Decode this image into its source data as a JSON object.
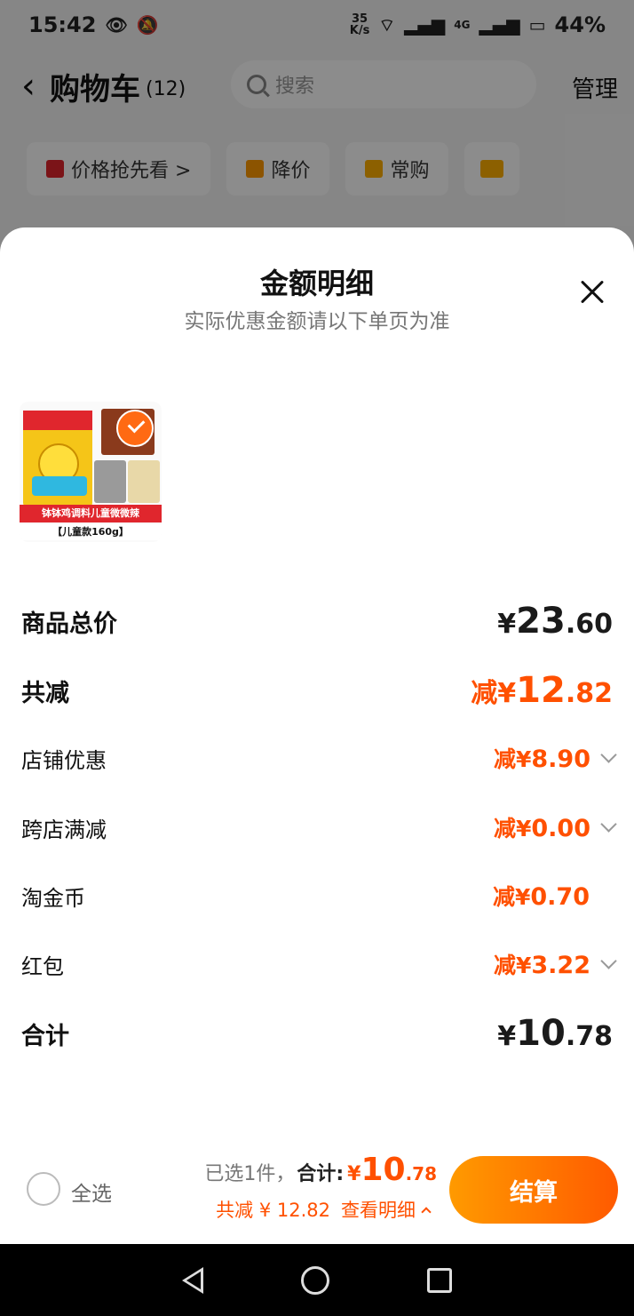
{
  "status_bar": {
    "time": "15:42",
    "speed_value": "35",
    "speed_unit": "K/s",
    "network": "4G",
    "battery": "44%"
  },
  "nav": {
    "title": "购物车",
    "count": "(12)",
    "search_placeholder": "搜索",
    "manage_label": "管理"
  },
  "filters": [
    {
      "label": "价格抢先看 >",
      "icon": "price-tag-icon",
      "color": "#e0262d"
    },
    {
      "label": "降价",
      "icon": "down-arrow-icon",
      "color": "#ff9a00"
    },
    {
      "label": "常购",
      "icon": "cart-icon",
      "color": "#ffb000"
    },
    {
      "label": "",
      "icon": "folder-icon",
      "color": "#ffb000"
    }
  ],
  "sheet": {
    "title": "金额明细",
    "subtitle": "实际优惠金额请以下单页为准",
    "product": {
      "banner": "钵钵鸡调料儿童微微辣",
      "tag": "【儿童款160g】"
    },
    "rows": [
      {
        "label": "商品总价",
        "prefix": "¥",
        "int": "23",
        "dec": ".60"
      },
      {
        "label": "共减",
        "prefix": "减¥",
        "int": "12",
        "dec": ".82"
      },
      {
        "label": "店铺优惠",
        "amount_prefix": "减¥",
        "amount": "8.90",
        "chevron": true
      },
      {
        "label": "跨店满减",
        "amount_prefix": "减¥",
        "amount": "0.00",
        "chevron": true
      },
      {
        "label": "淘金币",
        "amount_prefix": "减¥",
        "amount": "0.70",
        "chevron": false
      },
      {
        "label": "红包",
        "amount_prefix": "减¥",
        "amount": "3.22",
        "chevron": true
      },
      {
        "label": "合计",
        "prefix": "¥",
        "int": "10",
        "dec": ".78"
      }
    ]
  },
  "checkout": {
    "select_all": "全选",
    "selected_text": "已选1件，",
    "total_label": "合计:",
    "currency": "¥",
    "total_int": "10",
    "total_dec": ".78",
    "saved_text": "共减 ¥ 12.82",
    "view_detail": "查看明细",
    "button_label": "结算"
  },
  "colors": {
    "accent": "#ff5000",
    "button_start": "#ff9a00",
    "button_end": "#ff5a00"
  }
}
